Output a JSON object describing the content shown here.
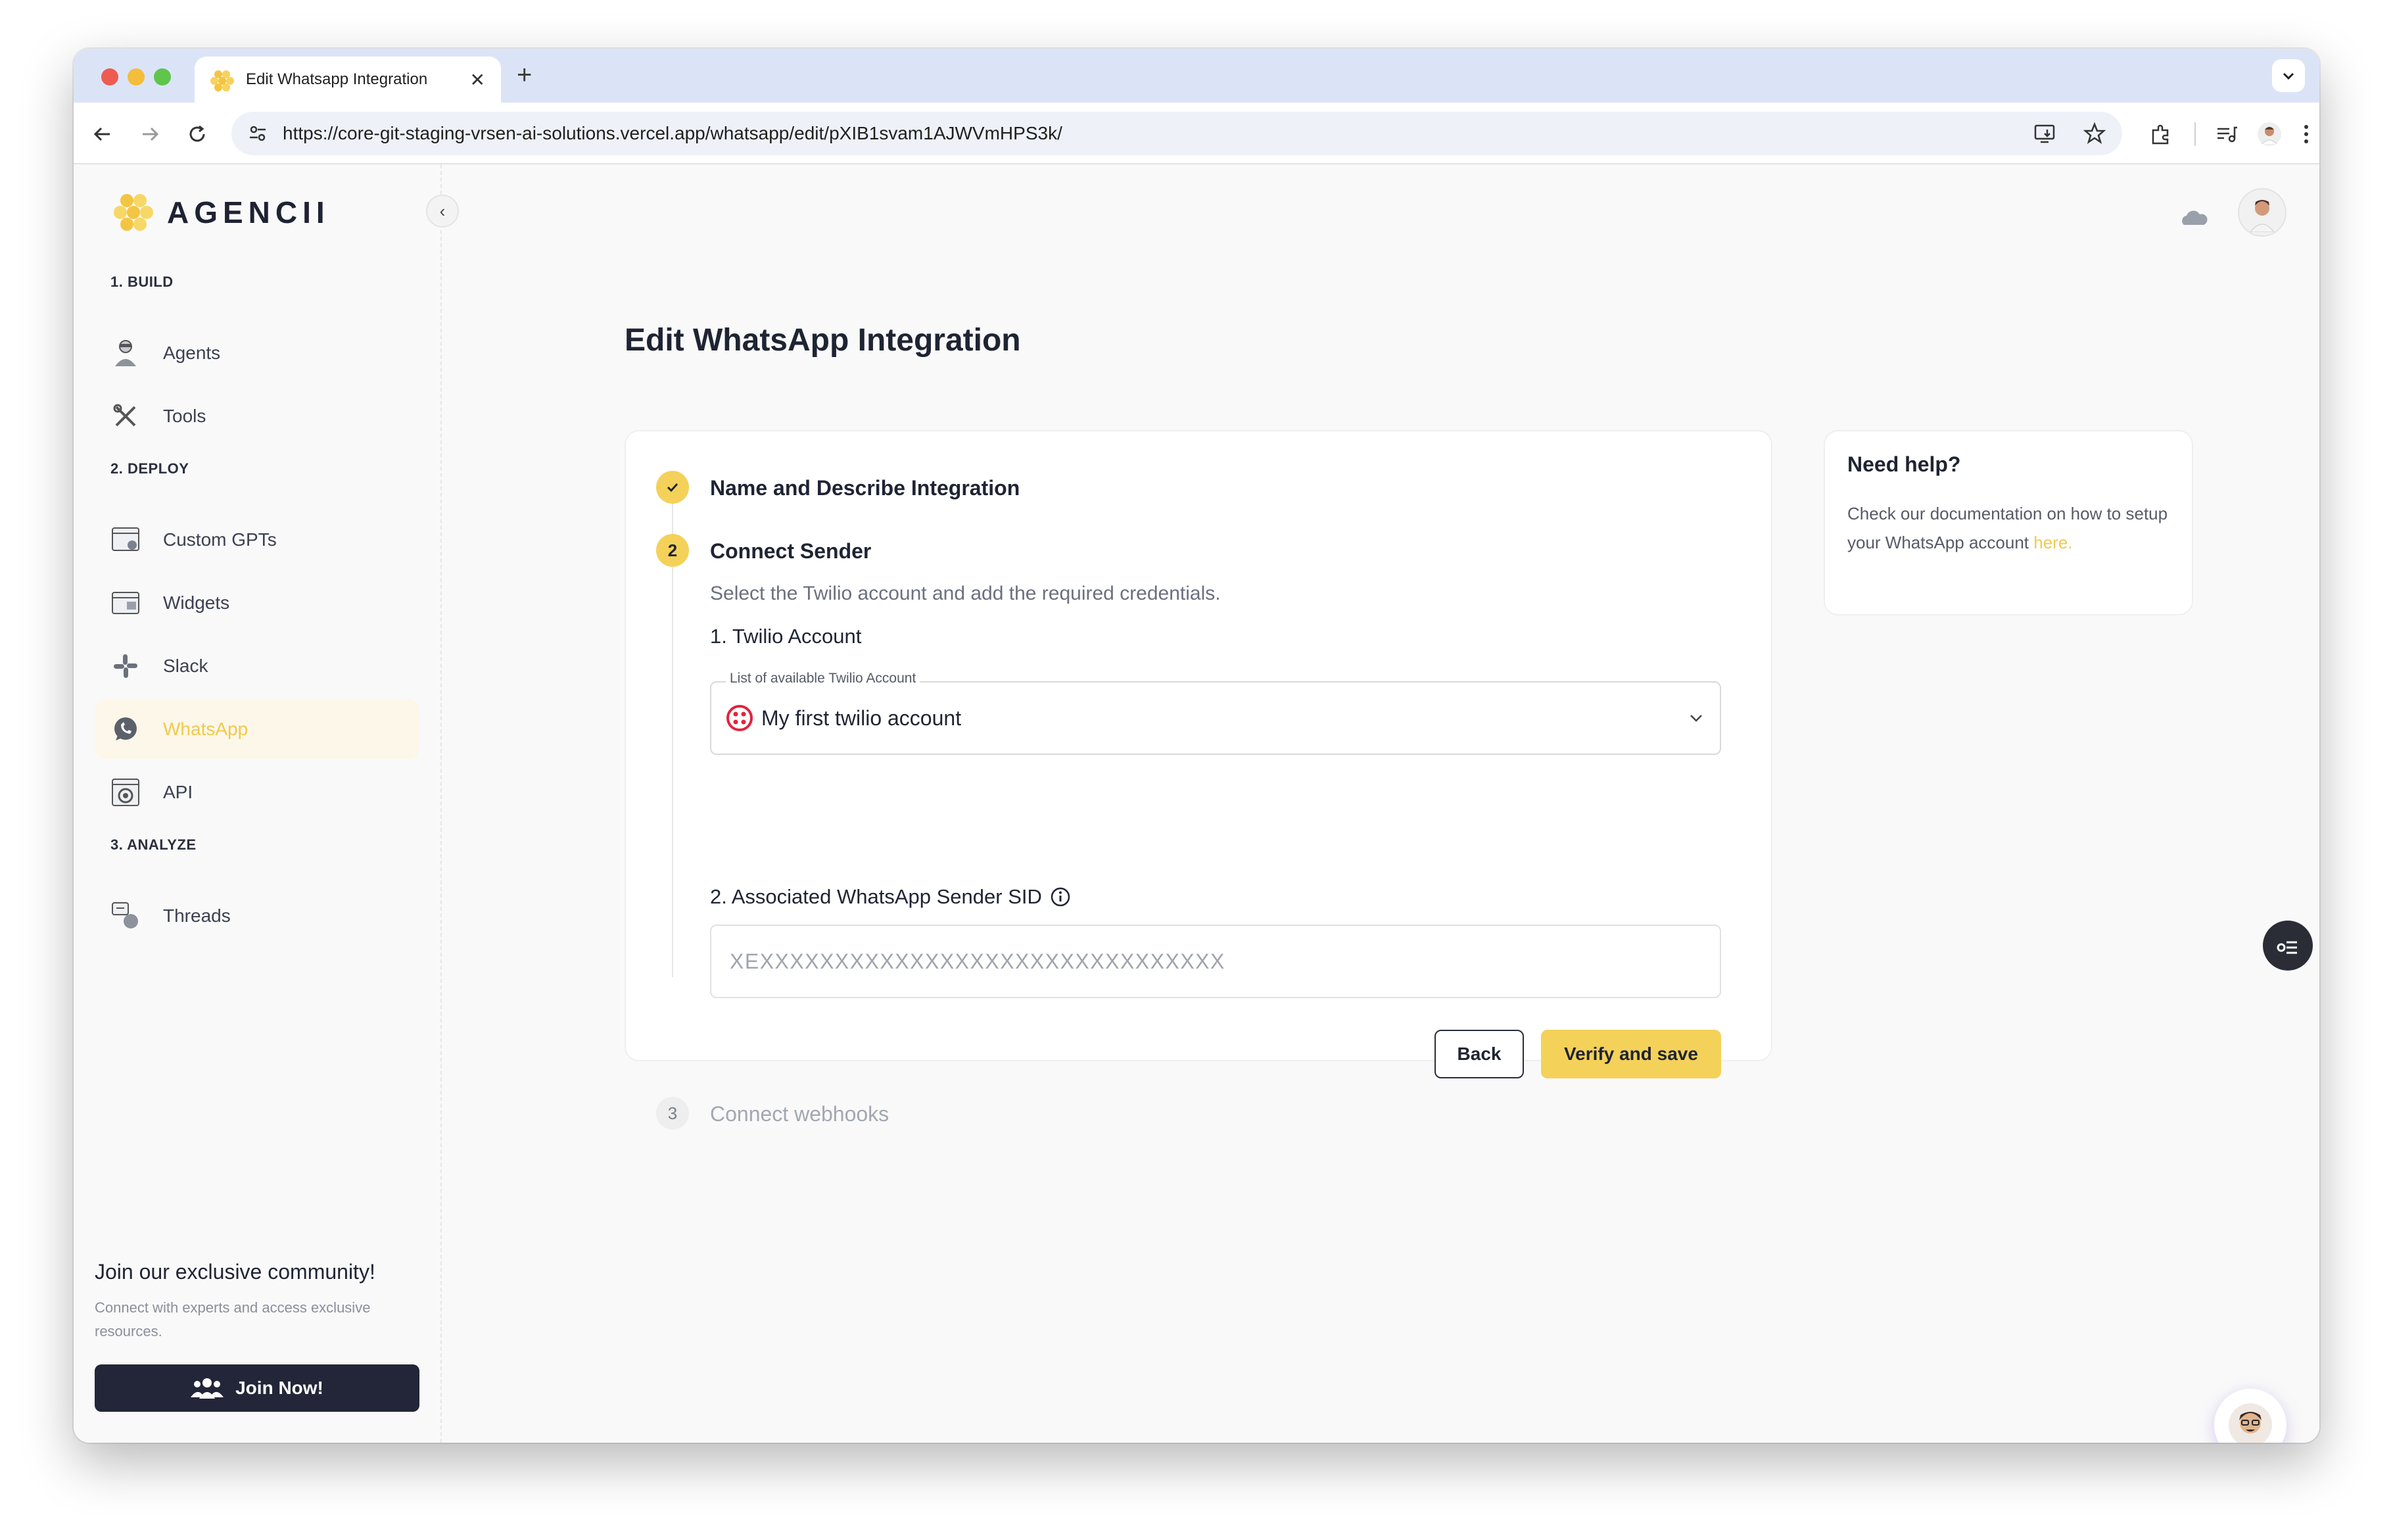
{
  "browser": {
    "tab_title": "Edit Whatsapp Integration",
    "tab_close": "✕",
    "new_tab": "+",
    "url": "https://core-git-staging-vrsen-ai-solutions.vercel.app/whatsapp/edit/pXIB1svam1AJWVmHPS3k/"
  },
  "sidebar": {
    "logo_text": "AGENCII",
    "collapse": "‹",
    "sections": [
      {
        "title": "1. BUILD"
      },
      {
        "title": "2. DEPLOY"
      },
      {
        "title": "3. ANALYZE"
      }
    ],
    "items": [
      {
        "label": "Agents"
      },
      {
        "label": "Tools"
      },
      {
        "label": "Custom GPTs"
      },
      {
        "label": "Widgets"
      },
      {
        "label": "Slack"
      },
      {
        "label": "WhatsApp"
      },
      {
        "label": "API"
      },
      {
        "label": "Threads"
      }
    ],
    "community": {
      "title": "Join our exclusive community!",
      "description": "Connect with experts and access exclusive resources.",
      "button": "Join Now!"
    }
  },
  "main": {
    "title": "Edit WhatsApp Integration",
    "steps": [
      {
        "title": "Name and Describe Integration",
        "number": ""
      },
      {
        "title": "Connect Sender",
        "number": "2"
      },
      {
        "title": "Connect webhooks",
        "number": "3"
      }
    ],
    "step2": {
      "description": "Select the Twilio account and add the required credentials.",
      "account_label": "1. Twilio Account",
      "account_legend": "List of available Twilio Account",
      "account_value": "My first twilio account",
      "sid_label": "2. Associated WhatsApp Sender SID",
      "sid_placeholder": "XEXXXXXXXXXXXXXXXXXXXXXXXXXXXXXXX",
      "back": "Back",
      "save": "Verify and save"
    }
  },
  "help": {
    "title": "Need help?",
    "text": "Check our documentation on how to setup your WhatsApp account ",
    "link": "here."
  },
  "colors": {
    "accent": "#f4d159",
    "dark": "#232638",
    "twilio": "#e2233b"
  }
}
